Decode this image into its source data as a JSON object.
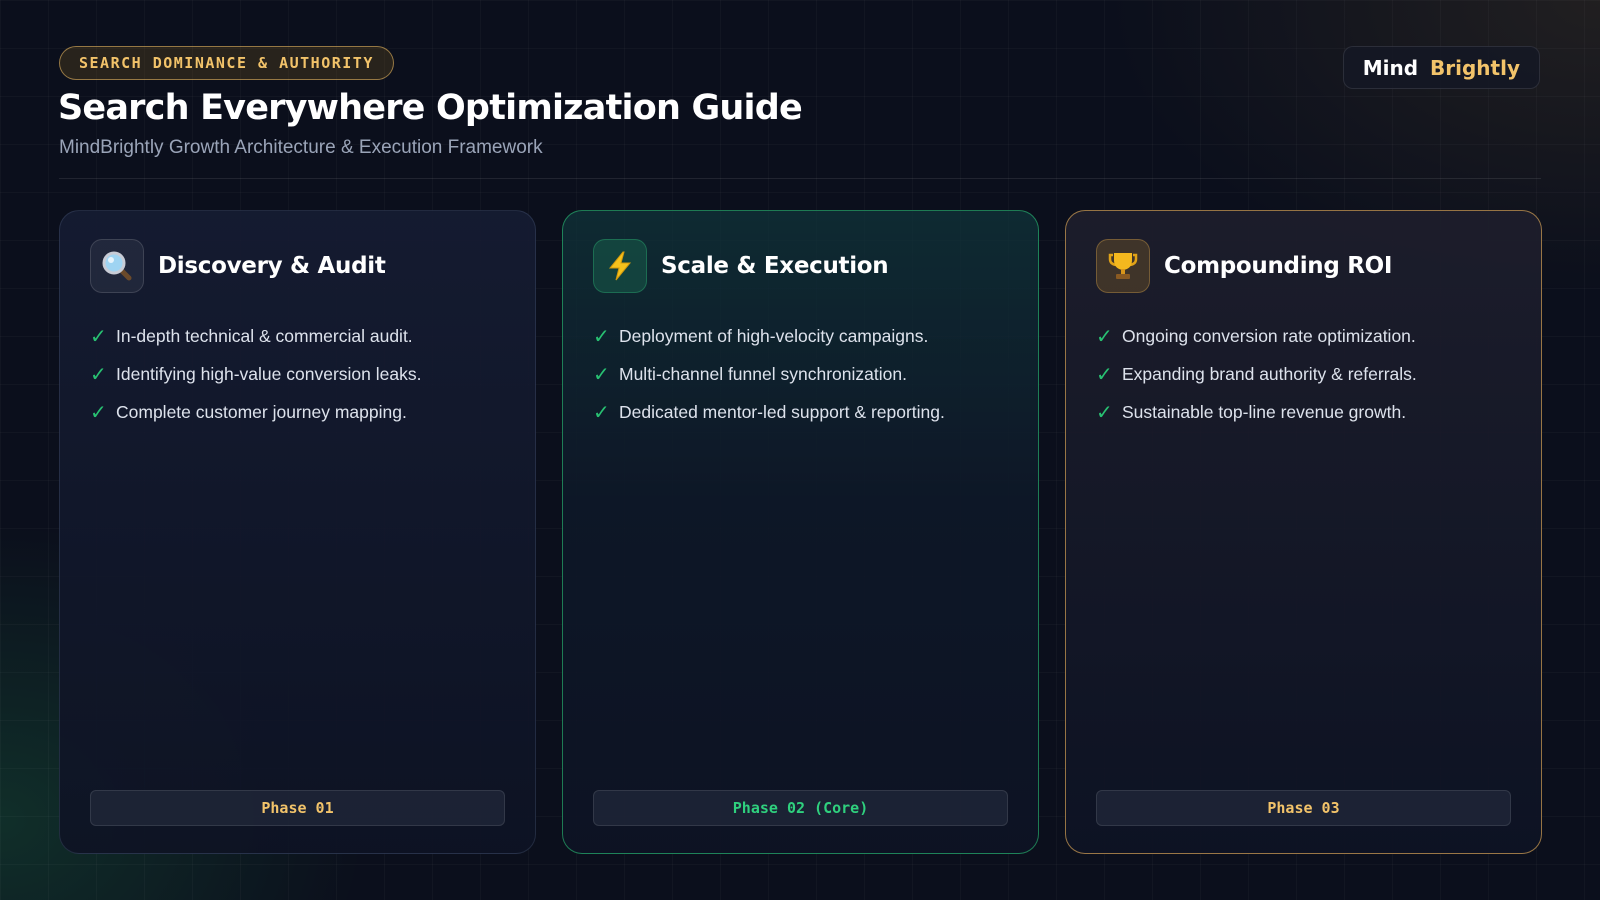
{
  "header": {
    "badge": "SEARCH DOMINANCE & AUTHORITY",
    "title": "Search Everywhere Optimization Guide",
    "subtitle": "MindBrightly Growth Architecture & Execution Framework"
  },
  "logo": {
    "word1": "Mind",
    "word2": "Brightly"
  },
  "cards": [
    {
      "icon": "magnifier-icon",
      "title": "Discovery & Audit",
      "items": [
        "In-depth technical & commercial audit.",
        "Identifying high-value conversion leaks.",
        "Complete customer journey mapping."
      ],
      "phase": "Phase 01"
    },
    {
      "icon": "lightning-icon",
      "title": "Scale & Execution",
      "items": [
        "Deployment of high-velocity campaigns.",
        "Multi-channel funnel synchronization.",
        "Dedicated mentor-led support & reporting."
      ],
      "phase": "Phase 02 (Core)"
    },
    {
      "icon": "trophy-icon",
      "title": "Compounding ROI",
      "items": [
        "Ongoing conversion rate optimization.",
        "Expanding brand authority & referrals.",
        "Sustainable top-line revenue growth."
      ],
      "phase": "Phase 03"
    }
  ],
  "check_symbol": "✓",
  "colors": {
    "background": "#0b0f1c",
    "accent_gold": "#f2c36a",
    "accent_green": "#28c172",
    "text_primary": "#ffffff",
    "text_muted": "#9aa4b8"
  }
}
